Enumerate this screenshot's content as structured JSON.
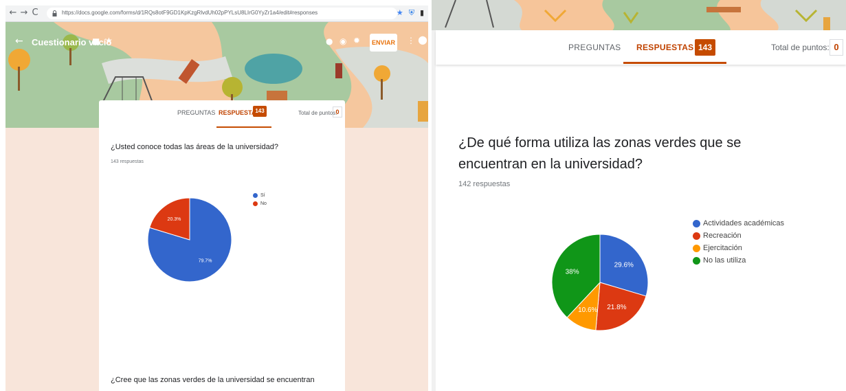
{
  "browser": {
    "url": "https://docs.google.com/forms/d/1RQs8otF9GD1KpKzgRlvdUh02pPYLsU8LIrG0YyZr1a4/edit#responses",
    "back": "←",
    "forward": "→",
    "reload": "C"
  },
  "header": {
    "form_title": "Cuestionario vacío",
    "send_label": "ENVIAR"
  },
  "tabs": {
    "questions_label": "PREGUNTAS",
    "responses_label": "RESPUESTAS",
    "response_count": "143",
    "total_points_label": "Total de puntos:",
    "total_points_value": "0"
  },
  "colors": {
    "accent": "#c54b00",
    "blue": "#3366cc",
    "red": "#dc3912",
    "orange": "#ff9900",
    "green": "#109618"
  },
  "left_panel": {
    "question_1": {
      "title": "¿Usted conoce todas las áreas de la universidad?",
      "response_count": "143 respuestas"
    },
    "question_2": {
      "title": "¿Cree que las zonas verdes de la universidad se encuentran"
    }
  },
  "right_panel": {
    "question": {
      "title": "¿De qué forma utiliza las zonas verdes que se encuentran en la universidad?",
      "response_count": "142 respuestas"
    }
  },
  "chart_data": [
    {
      "type": "pie",
      "categories": [
        "Sí",
        "No"
      ],
      "values": [
        79.7,
        20.3
      ],
      "labels": [
        "79.7%",
        "20.3%"
      ],
      "colors": [
        "#3366cc",
        "#dc3912"
      ],
      "legend_position": "right"
    },
    {
      "type": "pie",
      "categories": [
        "Actividades académicas",
        "Recreación",
        "Ejercitación",
        "No las utiliza"
      ],
      "values": [
        29.6,
        21.8,
        10.6,
        38
      ],
      "labels": [
        "29.6%",
        "21.8%",
        "10.6%",
        "38%"
      ],
      "colors": [
        "#3366cc",
        "#dc3912",
        "#ff9900",
        "#109618"
      ],
      "legend_position": "right"
    }
  ]
}
